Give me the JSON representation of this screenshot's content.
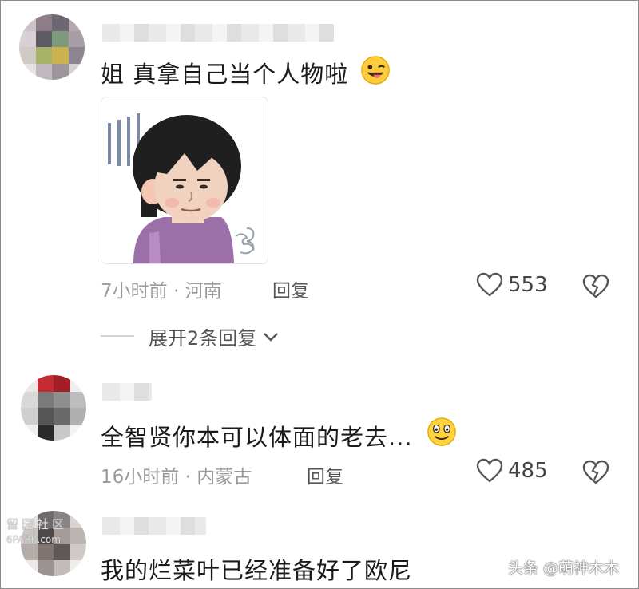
{
  "comments": [
    {
      "text": "姐 真拿自己当个人物啦",
      "meta": "7小时前 · 河南",
      "reply": "回复",
      "likes": "553",
      "expand": "展开2条回复",
      "emoji": "winking-tongue-emoji"
    },
    {
      "text": "全智贤你本可以体面的老去...",
      "meta": "16小时前 · 内蒙古",
      "reply": "回复",
      "likes": "485",
      "emoji": "smiling-emoji"
    },
    {
      "text": "我的烂菜叶已经准备好了欧尼"
    }
  ],
  "watermarks": {
    "left_top": "留园社区",
    "left_bottom": "6PARK.com",
    "right": "头条 @萌神木木"
  },
  "icons": {
    "like": "heart-outline-icon",
    "dislike": "broken-heart-icon",
    "expand": "chevron-down-icon"
  },
  "colors": {
    "text": "#1a1a1a",
    "meta": "#9a9a9a",
    "icon": "#555555",
    "divider": "#d4d4d4",
    "sticker_shirt": "#9b6fa8",
    "sticker_hair": "#1f1f1f"
  }
}
